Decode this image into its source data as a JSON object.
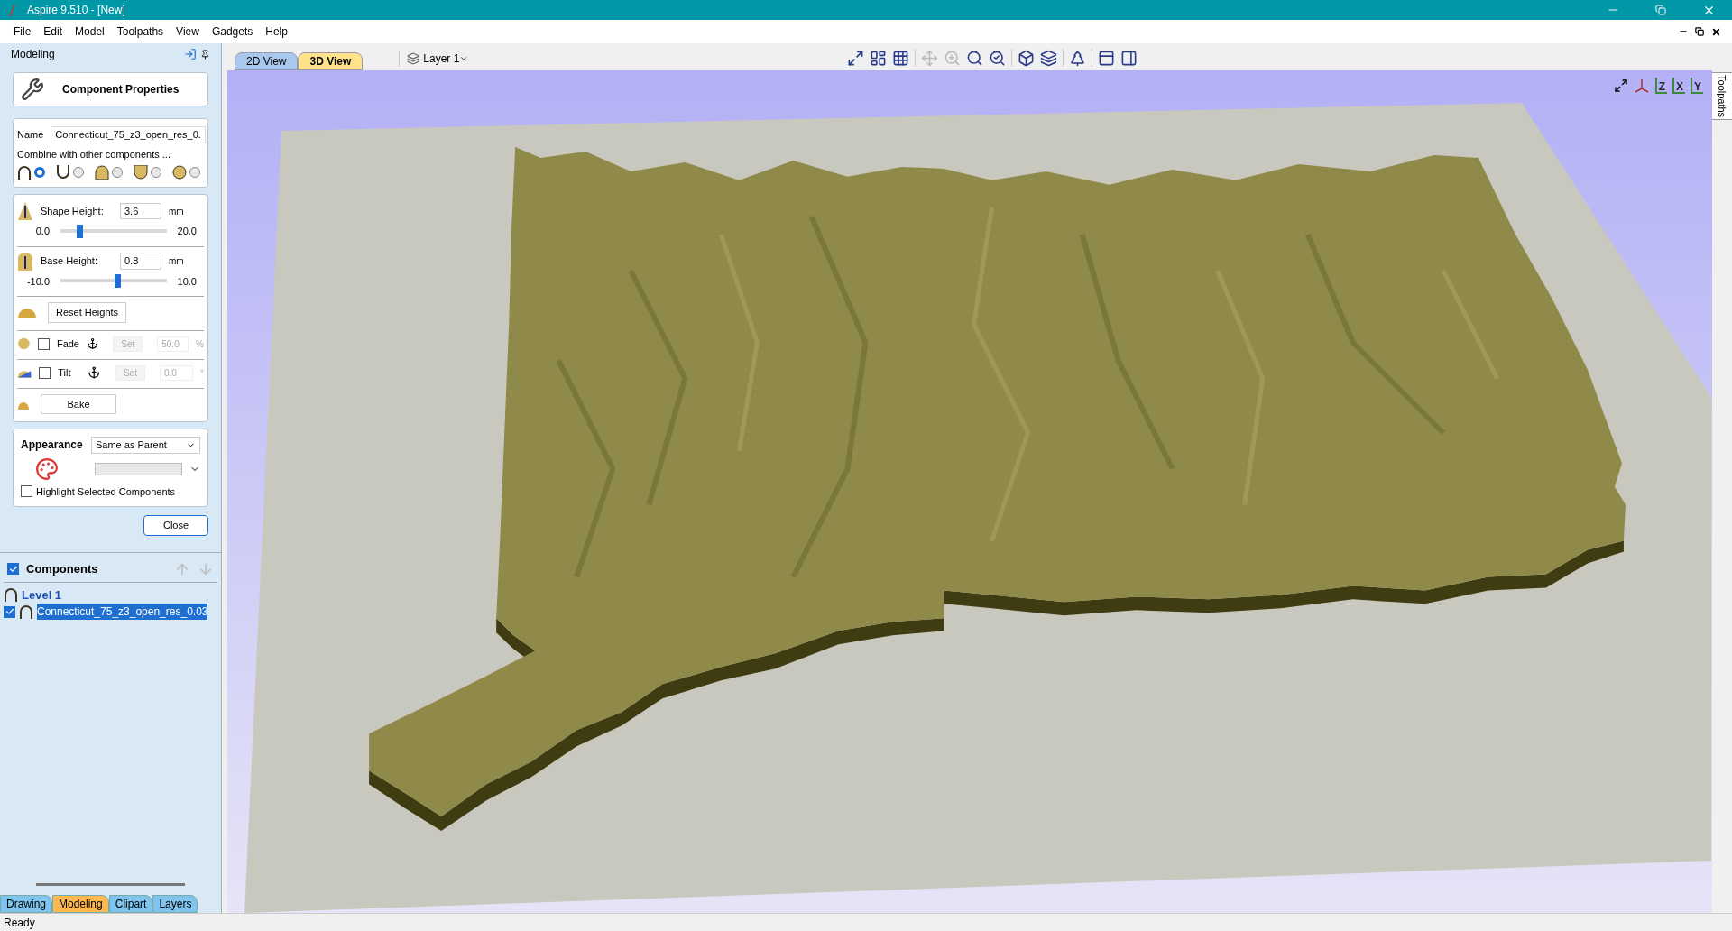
{
  "window": {
    "title": "Aspire 9.510 - [New]"
  },
  "menu": [
    "File",
    "Edit",
    "Model",
    "Toolpaths",
    "View",
    "Gadgets",
    "Help"
  ],
  "panel": {
    "title": "Modeling"
  },
  "properties": {
    "title": "Component Properties",
    "name_label": "Name",
    "name_value": "Connecticut_75_z3_open_res_0.",
    "combine_label": "Combine with other components ...",
    "combine_modes": [
      {
        "kind": "arch",
        "selected": true
      },
      {
        "kind": "cup",
        "selected": false
      },
      {
        "kind": "dome",
        "selected": false
      },
      {
        "kind": "filledcup",
        "selected": false
      },
      {
        "kind": "ball",
        "selected": false
      }
    ]
  },
  "heights": [
    {
      "label": "Shape Height:",
      "value": "3.6",
      "unit": "mm",
      "min": "0.0",
      "max": "20.0",
      "level": 0.18
    },
    {
      "label": "Base Height:",
      "value": "0.8",
      "unit": "mm",
      "min": "-10.0",
      "max": "10.0",
      "level": 0.54
    }
  ],
  "reset_button": "Reset Heights",
  "options": [
    {
      "label": "Fade",
      "checked": false,
      "set_label": "Set",
      "value": "50.0",
      "unit": "%"
    },
    {
      "label": "Tilt",
      "checked": false,
      "set_label": "Set",
      "value": "0.0",
      "unit": "°"
    }
  ],
  "bake_button": "Bake",
  "appearance": {
    "label": "Appearance",
    "value": "Same as Parent",
    "highlight_label": "Highlight Selected Components",
    "highlight_checked": false
  },
  "close_button": "Close",
  "components": {
    "label": "Components",
    "checked": true,
    "tree": [
      {
        "label": "Level 1",
        "children": [
          {
            "label": "Connecticut_75_z3_open_res_0.03",
            "checked": true,
            "selected": true
          }
        ]
      }
    ]
  },
  "bottom_tabs": [
    {
      "label": "Drawing",
      "selected": false
    },
    {
      "label": "Modeling",
      "selected": true
    },
    {
      "label": "Clipart",
      "selected": false
    },
    {
      "label": "Layers",
      "selected": false
    }
  ],
  "view_tabs": [
    {
      "label": "2D View",
      "selected": false
    },
    {
      "label": "3D View",
      "selected": true
    }
  ],
  "layer": "Layer 1",
  "view_axes": [
    "Z",
    "X",
    "Y"
  ],
  "side_tab": "Toolpaths",
  "status_bar": "Ready"
}
